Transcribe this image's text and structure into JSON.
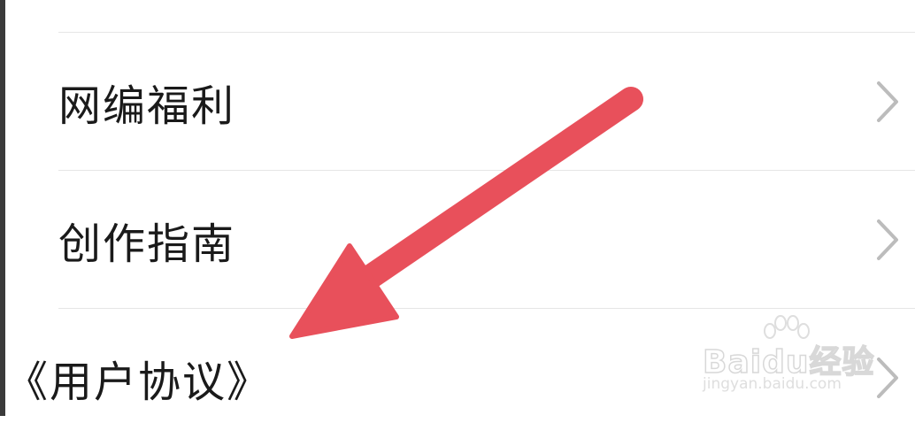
{
  "menu": {
    "items": [
      {
        "label": "网编福利"
      },
      {
        "label": "创作指南"
      },
      {
        "label": "《用户协议》"
      }
    ]
  },
  "overlay": {
    "arrow_color": "#e8505b"
  },
  "watermark": {
    "brand": "Baidu经验",
    "url": "jingyan.baidu.com"
  },
  "colors": {
    "divider": "#e6e6e6",
    "text": "#1a1a1a",
    "chevron": "#bcbcbc"
  }
}
